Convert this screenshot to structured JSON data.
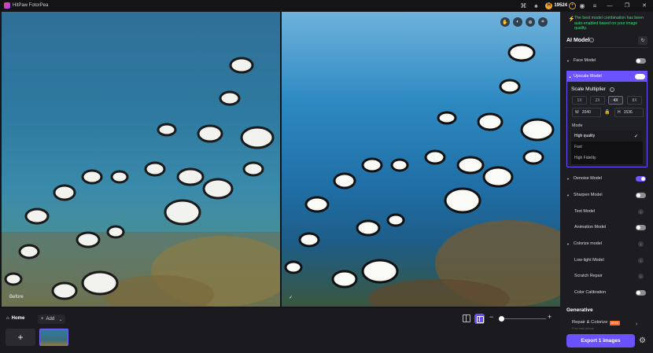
{
  "window": {
    "title": "HitPaw FotorPea",
    "credits": "19524",
    "controls": {
      "minimize": "—",
      "maximize": "❐",
      "close": "✕"
    }
  },
  "canvas": {
    "before_label": "Before",
    "after_label": "✓",
    "tools": [
      "hand-icon",
      "compare-icon",
      "zoom-icon",
      "crop-icon"
    ]
  },
  "bottom_bar": {
    "home_label": "Home",
    "add_label": "Add",
    "add_tile": "+",
    "zoom_minus": "−",
    "zoom_plus": "+",
    "zoom_level": 0.05
  },
  "panel": {
    "notice": "The best model combination has been auto-enabled based on your image quality.",
    "section_title": "AI Model",
    "models": [
      {
        "label": "Face Model",
        "on": false
      },
      {
        "label": "Upscale Model",
        "on": true
      },
      {
        "label": "Denoise Model",
        "on": true
      },
      {
        "label": "Sharpen Model",
        "on": false
      },
      {
        "label": "Text Model",
        "control": "download"
      },
      {
        "label": "Animation Model",
        "on": false
      },
      {
        "label": "Colorize model",
        "control": "download"
      },
      {
        "label": "Low-light Model",
        "control": "download"
      },
      {
        "label": "Scratch Repair",
        "control": "download"
      },
      {
        "label": "Color Calibration",
        "on": false
      }
    ],
    "upscale": {
      "scale_title": "Scale Multiplier",
      "multipliers": [
        "1X",
        "2X",
        "4X",
        "8X"
      ],
      "selected_multiplier": "4X",
      "width_label": "W",
      "width_value": "2040",
      "height_label": "H",
      "height_value": "1536",
      "mode_title": "Mode",
      "modes": [
        "High quality",
        "Fast",
        "High Fidelity"
      ],
      "selected_mode": "High quality"
    },
    "generative_title": "Generative",
    "repair_label": "Repair & Colorize",
    "repair_badge": "BETA",
    "repair_sub": "Free stall picture",
    "export_label": "Export 1 images"
  },
  "colors": {
    "accent": "#6a52ff",
    "notice": "#36e07a",
    "beta": "#ff6a2b"
  }
}
